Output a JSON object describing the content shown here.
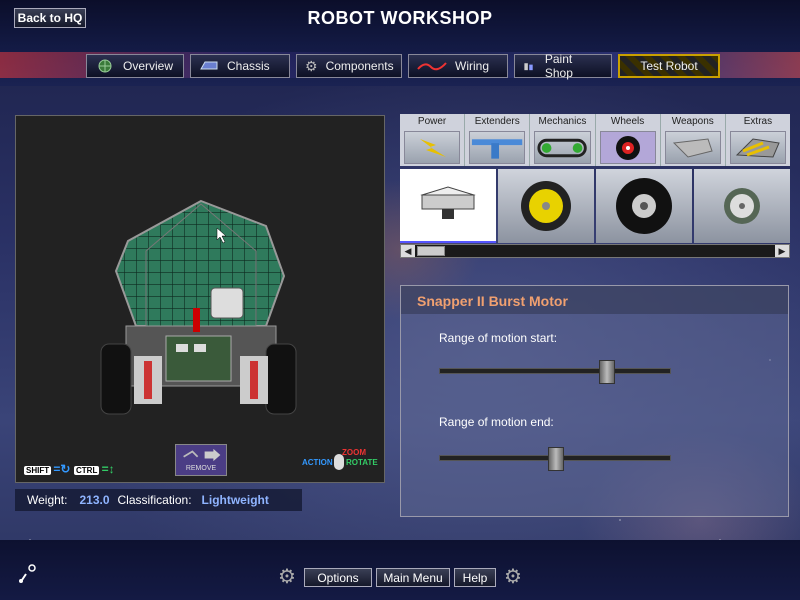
{
  "header": {
    "back_label": "Back to HQ",
    "title": "ROBOT WORKSHOP"
  },
  "tabs": [
    {
      "label": "Overview",
      "icon": "globe-icon"
    },
    {
      "label": "Chassis",
      "icon": "chassis-icon"
    },
    {
      "label": "Components",
      "icon": "gear-icon"
    },
    {
      "label": "Wiring",
      "icon": "wire-icon"
    },
    {
      "label": "Paint Shop",
      "icon": "paint-icon"
    },
    {
      "label": "Test Robot",
      "icon": ""
    }
  ],
  "categories": [
    {
      "label": "Power",
      "icon": "lightning-icon"
    },
    {
      "label": "Extenders",
      "icon": "t-bar-icon"
    },
    {
      "label": "Mechanics",
      "icon": "chain-icon"
    },
    {
      "label": "Wheels",
      "icon": "wheel-icon",
      "selected": true
    },
    {
      "label": "Weapons",
      "icon": "wedge-icon"
    },
    {
      "label": "Extras",
      "icon": "plow-icon"
    }
  ],
  "items": [
    {
      "name": "motor-item",
      "selected": true
    },
    {
      "name": "yellow-wheel-item"
    },
    {
      "name": "tire-wheel-item"
    },
    {
      "name": "small-wheel-item"
    }
  ],
  "viewport": {
    "hint_shift": "SHIFT",
    "hint_ctrl": "CTRL",
    "remove_label": "REMOVE",
    "action_label": "ACTION",
    "zoom_label": "ZOOM",
    "rotate_label": "ROTATE"
  },
  "status": {
    "weight_label": "Weight:",
    "weight_value": "213.0",
    "class_label": "Classification:",
    "class_value": "Lightweight"
  },
  "detail": {
    "name": "Snapper II Burst Motor",
    "start_label": "Range of motion start:",
    "start_value": 0.72,
    "end_label": "Range of motion end:",
    "end_value": 0.5
  },
  "footer": {
    "options": "Options",
    "main_menu": "Main Menu",
    "help": "Help"
  },
  "colors": {
    "accent_orange": "#f0a070",
    "value_blue": "#8fb4ff",
    "test_border": "#c9a000"
  }
}
